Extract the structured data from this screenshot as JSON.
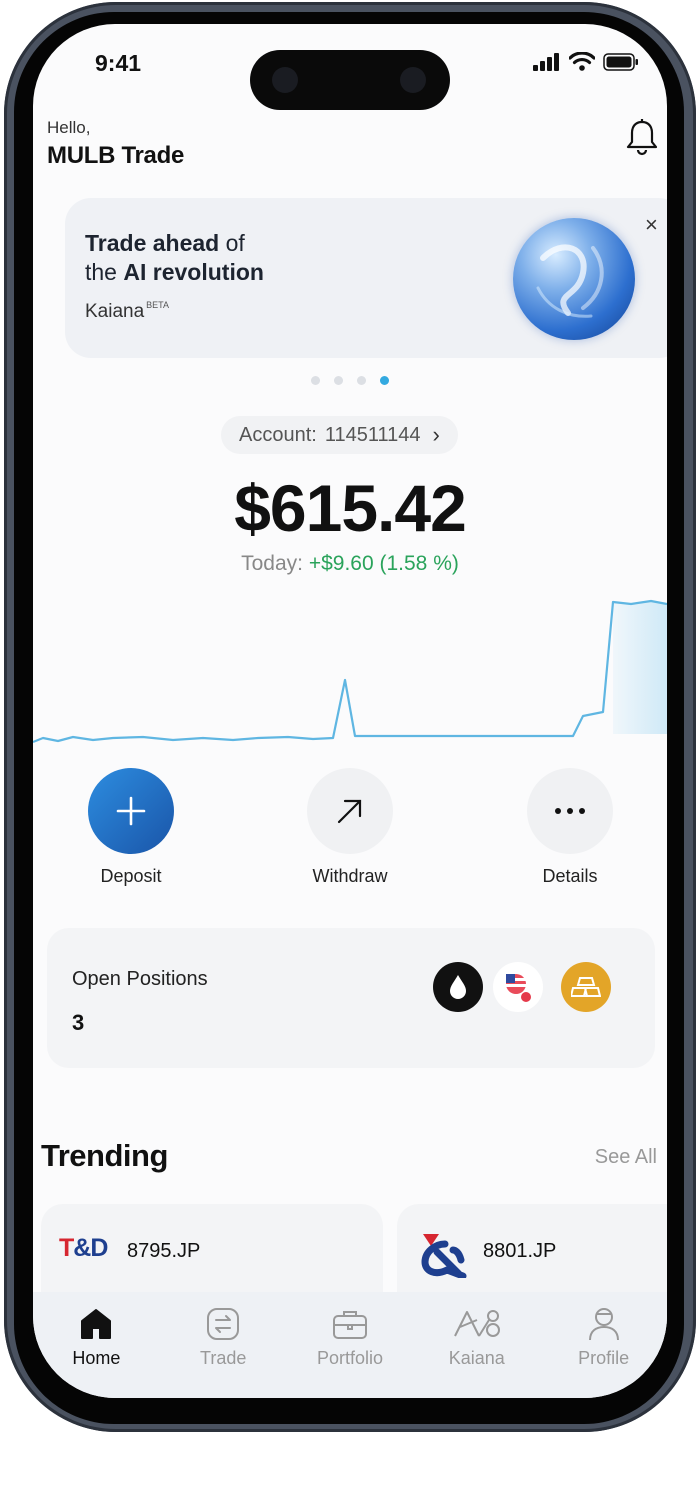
{
  "status_bar": {
    "time": "9:41"
  },
  "header": {
    "greeting": "Hello,",
    "account_name": "MULB Trade"
  },
  "promo": {
    "line1_bold": "Trade ahead",
    "line1_rest": " of",
    "line2_pre": "the ",
    "line2_bold": "AI revolution",
    "brand": "Kaiana",
    "badge": "BETA",
    "close_glyph": "×",
    "carousel_total": 4,
    "carousel_active": 4
  },
  "account": {
    "label": "Account:",
    "number": "114511144",
    "chevron": "›"
  },
  "balance": {
    "amount": "$615.42",
    "today_label": "Today:",
    "today_change": "+$9.60 (1.58 %)"
  },
  "actions": {
    "deposit": "Deposit",
    "withdraw": "Withdraw",
    "details": "Details"
  },
  "positions": {
    "title": "Open Positions",
    "count": "3"
  },
  "trending": {
    "title": "Trending",
    "see_all": "See All",
    "items": [
      {
        "ticker": "8795.JP",
        "logo": "T&D"
      },
      {
        "ticker": "8801.JP",
        "logo": "&"
      }
    ]
  },
  "nav": {
    "items": [
      {
        "label": "Home",
        "icon": "home-icon",
        "active": true
      },
      {
        "label": "Trade",
        "icon": "trade-icon",
        "active": false
      },
      {
        "label": "Portfolio",
        "icon": "portfolio-icon",
        "active": false
      },
      {
        "label": "Kaiana",
        "icon": "kaiana-icon",
        "active": false
      },
      {
        "label": "Profile",
        "icon": "profile-icon",
        "active": false
      }
    ]
  },
  "colors": {
    "accent": "#33a9e0",
    "gain": "#2aa35b",
    "deposit": "#1e6fc8"
  }
}
